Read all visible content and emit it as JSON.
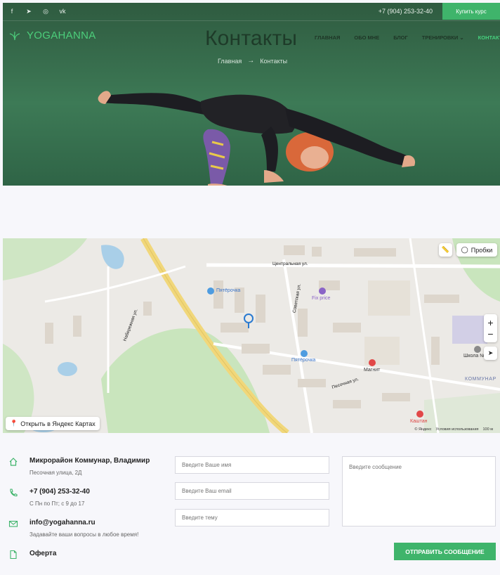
{
  "topbar": {
    "social": [
      {
        "icon": "facebook-icon",
        "glyph": "f"
      },
      {
        "icon": "telegram-icon",
        "glyph": "➤"
      },
      {
        "icon": "instagram-icon",
        "glyph": "◎"
      },
      {
        "icon": "vk-icon",
        "glyph": "vk"
      }
    ],
    "phone": "+7 (904) 253-32-40",
    "buy_button": "Купить курс"
  },
  "logo": {
    "text": "YOGAHANNA",
    "icon": "lotus-icon",
    "color": "#4ccf7b"
  },
  "page_title": "Контакты",
  "nav": [
    {
      "label": "ГЛАВНАЯ"
    },
    {
      "label": "ОБО МНЕ"
    },
    {
      "label": "БЛОГ"
    },
    {
      "label": "ТРЕНИРОВКИ ⌄"
    },
    {
      "label": "КОНТАКТЫ"
    }
  ],
  "breadcrumb": {
    "home": "Главная",
    "arrow": "→",
    "current": "Контакты"
  },
  "map": {
    "open_label": "Открыть в Яндекс Картах",
    "traffic_label": "Пробки",
    "zoom_in": "+",
    "zoom_out": "−",
    "copyright": "© Яндекс",
    "terms": "Условия использования",
    "scale": "100 м",
    "pois": [
      "Пятёрочка",
      "Пятёрочка",
      "Fix price",
      "Магнит",
      "Школа №",
      "Каштан"
    ],
    "streets": [
      "Центральная ул.",
      "Советская ул.",
      "Песочная ул.",
      "Набережная ул.",
      "КОММУНАР"
    ]
  },
  "contacts": {
    "address_title": "Микрорайон Коммунар, Владимир",
    "address_sub": "Песочная улица, 2Д",
    "phone_title": "+7 (904) 253-32-40",
    "phone_sub": "С Пн по Пт; с 9 до 17",
    "email_title": "info@yogahanna.ru",
    "email_sub": "Задавайте ваши вопросы в любое время!",
    "offer": "Оферта"
  },
  "form": {
    "name_placeholder": "Введите Ваше имя",
    "email_placeholder": "Введите Ваш email",
    "subject_placeholder": "Введите тему",
    "message_placeholder": "Введите сообщение",
    "submit": "ОТПРАВИТЬ СООБЩЕНИЕ"
  },
  "colors": {
    "accent": "#3fb46b",
    "hero_bg": "#3d7a56"
  }
}
